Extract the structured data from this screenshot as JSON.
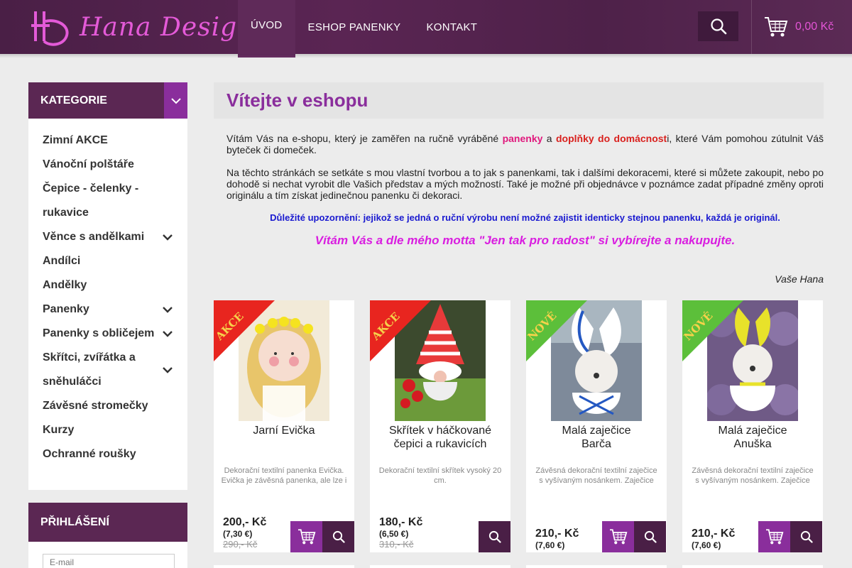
{
  "brand": {
    "name": "Hana Design",
    "accent": "#8a2e9c",
    "pink": "#e454d6",
    "header_bg": "#4a1f46"
  },
  "nav": [
    {
      "label": "ÚVOD",
      "active": true
    },
    {
      "label": "ESHOP PANENKY",
      "active": false
    },
    {
      "label": "KONTAKT",
      "active": false
    }
  ],
  "header": {
    "search_icon": "search-icon",
    "cart_icon": "cart-icon",
    "cart_total": "0,00 Kč"
  },
  "sidebar": {
    "categories_title": "KATEGORIE",
    "categories": [
      {
        "label": "Zimní AKCE",
        "expandable": false
      },
      {
        "label": "Vánoční polštáře",
        "expandable": false
      },
      {
        "label": "Čepice - čelenky -",
        "label2": "rukavice",
        "expandable": false
      },
      {
        "label": "Věnce s andělkami",
        "expandable": true
      },
      {
        "label": "Andílci",
        "expandable": false
      },
      {
        "label": "Andělky",
        "expandable": false
      },
      {
        "label": "Panenky",
        "expandable": true
      },
      {
        "label": "Panenky s obličejem",
        "expandable": true
      },
      {
        "label": "Skřítci, zvířátka a",
        "label2": "sněhuláčci",
        "expandable": true
      },
      {
        "label": "Závěsné stromečky",
        "expandable": false
      },
      {
        "label": "Kurzy",
        "expandable": false
      },
      {
        "label": "Ochranné roušky",
        "expandable": false
      }
    ],
    "login_title": "PŘIHLÁŠENÍ",
    "email_placeholder": "E-mail"
  },
  "main": {
    "title": "Vítejte v eshopu",
    "intro1_a": "Vítám Vás na e-shopu, který je zaměřen na ručně vyráběné ",
    "intro1_b": "panenky",
    "intro1_c": " a ",
    "intro1_d": "doplňky do domácnost",
    "intro1_e": "i, které Vám pomohou zútulnit Váš byteček či domeček.",
    "intro2": "Na těchto stránkách se setkáte s mou vlastní tvorbou a to jak s panenkami, tak i dalšími dekoracemi, které si můžete zakoupit, nebo po dohodě si nechat vyrobit dle Vašich představ a mých možností. Také je možné při objednávce v poznámce zadat případné změny oproti originálu a tím získat jedinečnou panenku či dekoraci.",
    "notice": "Důležité upozornění: jejikož se jedná o ruční výrobu není možné zajistit identicky stejnou panenku, každá je originál.",
    "motto": "Vítám Vás a dle mého motta \"Jen tak pro radost\" si vybírejte a nakupujte.",
    "signature": "Vaše Hana"
  },
  "products": [
    {
      "ribbon": "AKCE",
      "ribbon_color": "#e8251f",
      "name": "Jarní Evička",
      "desc": "Dekorační textilní panenka Evička. Evička je závěsná panenka, ale lze i",
      "price": "200,- Kč",
      "price_eur": "(7,30 €)",
      "price_old": "290,- Kč",
      "has_cart": true,
      "img": "doll-blonde"
    },
    {
      "ribbon": "AKCE",
      "ribbon_color": "#e8251f",
      "name": "Skřítek v háčkované čepici a rukavicích",
      "desc": "Dekorační textilní skřítek vysoký 20 cm.",
      "price": "180,- Kč",
      "price_eur": "(6,50 €)",
      "price_old": "310,- Kč",
      "has_cart": false,
      "img": "gnome"
    },
    {
      "ribbon": "NOVÉ",
      "ribbon_color": "#5cbf3a",
      "name": "Malá zaječice Barča",
      "desc": "Závěsná dekorační textilní zaječice s vyšívaným nosánkem. Zaječice",
      "price": "210,- Kč",
      "price_eur": "(7,60 €)",
      "price_old": "",
      "has_cart": true,
      "img": "bunny-blue"
    },
    {
      "ribbon": "NOVÉ",
      "ribbon_color": "#5cbf3a",
      "name": "Malá zaječice Anuška",
      "desc": "Závěsná dekorační textilní zaječice s vyšívaným nosánkem. Zaječice",
      "price": "210,- Kč",
      "price_eur": "(7,60 €)",
      "price_old": "",
      "has_cart": true,
      "img": "bunny-yellow"
    }
  ]
}
